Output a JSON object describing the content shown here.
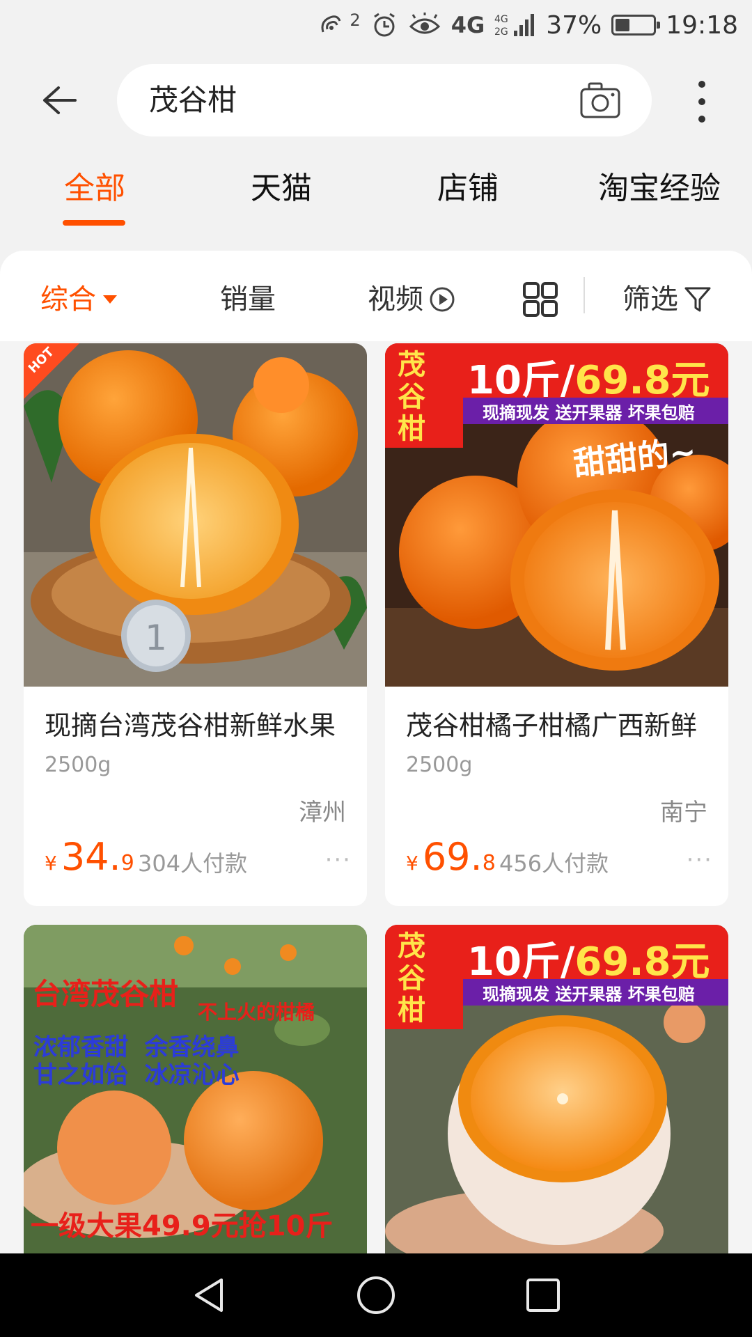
{
  "status_bar": {
    "notification_count": "2",
    "network": "4G",
    "network_secondary": "4G 2G",
    "battery_percent": "37%",
    "battery_level": 0.37,
    "time": "19:18"
  },
  "search": {
    "query": "茂谷柑"
  },
  "tabs": [
    {
      "label": "全部",
      "active": true
    },
    {
      "label": "天猫",
      "active": false
    },
    {
      "label": "店铺",
      "active": false
    },
    {
      "label": "淘宝经验",
      "active": false
    }
  ],
  "sort_bar": {
    "comprehensive": "综合",
    "sales": "销量",
    "video": "视频",
    "filter": "筛选"
  },
  "products": [
    {
      "title": "现摘台湾茂谷柑新鲜水果",
      "spec": "2500g",
      "location": "漳州",
      "currency": "¥",
      "price_int": "34.",
      "price_dec": "9",
      "sales": "304人付款",
      "badge": "HOT"
    },
    {
      "title": "茂谷柑橘子柑橘广西新鲜",
      "spec": "2500g",
      "location": "南宁",
      "currency": "¥",
      "price_int": "69.",
      "price_dec": "8",
      "sales": "456人付款",
      "banner_side": "茂谷柑",
      "banner_main_a": "10斤/",
      "banner_main_b": "69.8元",
      "banner_sub": "现摘现发 送开果器 坏果包赔",
      "overlay": "甜甜的~"
    },
    {
      "banner_title": "台湾茂谷柑",
      "banner_tag": "不上火的柑橘",
      "line1": "浓郁香甜  余香绕鼻",
      "line2": "甘之如饴  冰凉沁心",
      "bottom": "一级大果49.9元抢10斤"
    },
    {
      "banner_side": "茂谷柑",
      "banner_main_a": "10斤/",
      "banner_main_b": "69.8元",
      "banner_sub": "现摘现发 送开果器 坏果包赔"
    }
  ],
  "more_dots": "···"
}
